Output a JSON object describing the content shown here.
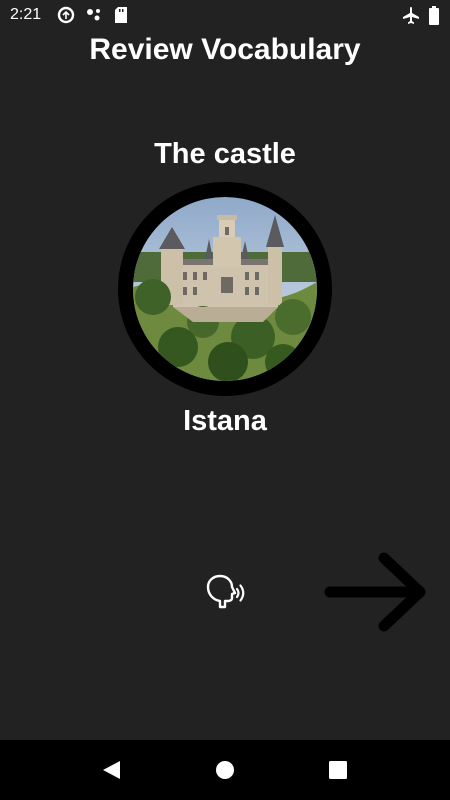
{
  "status_bar": {
    "time": "2:21",
    "left_icons": [
      "data-saver-icon",
      "assistant-dots-icon",
      "sd-card-icon"
    ],
    "right_icons": [
      "airplane-mode-icon",
      "battery-icon"
    ]
  },
  "header": {
    "title": "Review Vocabulary"
  },
  "card": {
    "word": "The castle",
    "translation": "Istana",
    "image": "castle-photo"
  },
  "actions": {
    "speak_icon": "speak-icon",
    "next_icon": "arrow-right-icon"
  },
  "nav_bar": {
    "buttons": [
      "back-icon",
      "home-icon",
      "recents-icon"
    ]
  },
  "colors": {
    "background": "#222222",
    "text": "#ffffff",
    "ring": "#000000",
    "nav_bar": "#000000"
  }
}
